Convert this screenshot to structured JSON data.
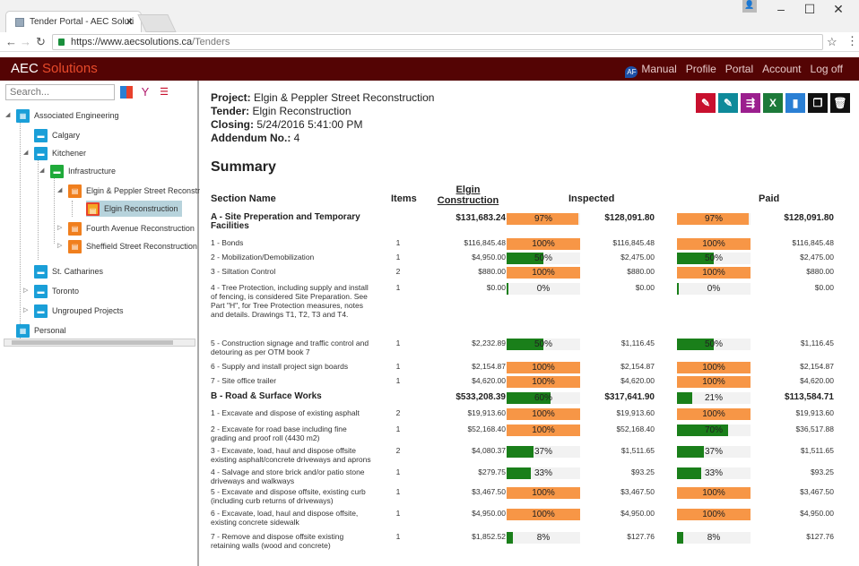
{
  "browser": {
    "tab_title": "Tender Portal - AEC Soluti",
    "url_host": "https://www.aecsolutions.ca",
    "url_path": "/Tenders"
  },
  "app": {
    "brand_a": "AEC",
    "brand_b": "Solutions",
    "nav": [
      "Manual",
      "Profile",
      "Portal",
      "Account",
      "Log off"
    ]
  },
  "sidebar": {
    "search_placeholder": "Search...",
    "tree": [
      {
        "label": "Associated Engineering"
      },
      {
        "label": "Calgary"
      },
      {
        "label": "Kitchener"
      },
      {
        "label": "Infrastructure"
      },
      {
        "label": "Elgin & Peppler Street Reconstr"
      },
      {
        "label": "Elgin Reconstruction"
      },
      {
        "label": "Fourth Avenue Reconstruction"
      },
      {
        "label": "Sheffield Street Reconstruction"
      },
      {
        "label": "St. Catharines"
      },
      {
        "label": "Toronto"
      },
      {
        "label": "Ungrouped Projects"
      },
      {
        "label": "Personal"
      }
    ]
  },
  "project": {
    "project_label": "Project:",
    "project": "Elgin & Peppler Street Reconstruction",
    "tender_label": "Tender:",
    "tender": "Elgin Reconstruction",
    "closing_label": "Closing:",
    "closing": "5/24/2016 5:41:00 PM",
    "addendum_label": "Addendum No.:",
    "addendum": "4"
  },
  "summary_title": "Summary",
  "table": {
    "headers": {
      "section": "Section Name",
      "items": "Items",
      "elgin": "Elgin Construction",
      "inspected": "Inspected",
      "paid": "Paid"
    },
    "rows": [
      {
        "name": "A - Site Preperation and Temporary Facilities",
        "items": "",
        "amt": "$131,683.24",
        "ins_pct": "97%",
        "ins_amt": "$128,091.80",
        "paid_pct": "97%",
        "paid_amt": "$128,091.80",
        "sec": true
      },
      {
        "name": "1 - Bonds",
        "items": "1",
        "amt": "$116,845.48",
        "ins_pct": "100%",
        "ins_amt": "$116,845.48",
        "paid_pct": "100%",
        "paid_amt": "$116,845.48"
      },
      {
        "name": "2 - Mobilization/Demobilization",
        "items": "1",
        "amt": "$4,950.00",
        "ins_pct": "50%",
        "ins_amt": "$2,475.00",
        "paid_pct": "50%",
        "paid_amt": "$2,475.00"
      },
      {
        "name": "3 - Siltation Control",
        "items": "2",
        "amt": "$880.00",
        "ins_pct": "100%",
        "ins_amt": "$880.00",
        "paid_pct": "100%",
        "paid_amt": "$880.00"
      },
      {
        "name": "4 - Tree Protection, including supply and install of fencing, is considered Site Preparation. See Part \"H\", for Tree Protection measures, notes and details. Drawings T1, T2, T3 and T4.",
        "items": "1",
        "amt": "$0.00",
        "ins_pct": "0%",
        "ins_amt": "$0.00",
        "paid_pct": "0%",
        "paid_amt": "$0.00"
      },
      {
        "name": "5 - Construction signage and traffic control and detouring as per OTM book 7",
        "items": "1",
        "amt": "$2,232.89",
        "ins_pct": "50%",
        "ins_amt": "$1,116.45",
        "paid_pct": "50%",
        "paid_amt": "$1,116.45"
      },
      {
        "name": "6 - Supply and install project sign boards",
        "items": "1",
        "amt": "$2,154.87",
        "ins_pct": "100%",
        "ins_amt": "$2,154.87",
        "paid_pct": "100%",
        "paid_amt": "$2,154.87"
      },
      {
        "name": "7 - Site office trailer",
        "items": "1",
        "amt": "$4,620.00",
        "ins_pct": "100%",
        "ins_amt": "$4,620.00",
        "paid_pct": "100%",
        "paid_amt": "$4,620.00"
      },
      {
        "name": "B - Road & Surface Works",
        "items": "",
        "amt": "$533,208.39",
        "ins_pct": "60%",
        "ins_amt": "$317,641.90",
        "paid_pct": "21%",
        "paid_amt": "$113,584.71",
        "sec": true
      },
      {
        "name": "1 - Excavate and dispose of existing asphalt",
        "items": "2",
        "amt": "$19,913.60",
        "ins_pct": "100%",
        "ins_amt": "$19,913.60",
        "paid_pct": "100%",
        "paid_amt": "$19,913.60"
      },
      {
        "name": "2 - Excavate for road base including fine grading and proof roll (4430 m2)",
        "items": "1",
        "amt": "$52,168.40",
        "ins_pct": "100%",
        "ins_amt": "$52,168.40",
        "paid_pct": "70%",
        "paid_amt": "$36,517.88"
      },
      {
        "name": "3 - Excavate, load, haul and dispose offsite existing asphalt/concrete driveways and aprons",
        "items": "2",
        "amt": "$4,080.37",
        "ins_pct": "37%",
        "ins_amt": "$1,511.65",
        "paid_pct": "37%",
        "paid_amt": "$1,511.65"
      },
      {
        "name": "4 - Salvage and store brick and/or patio stone driveways and walkways",
        "items": "1",
        "amt": "$279.75",
        "ins_pct": "33%",
        "ins_amt": "$93.25",
        "paid_pct": "33%",
        "paid_amt": "$93.25"
      },
      {
        "name": "5 - Excavate and dispose offsite, existing curb (including curb returns of driveways)",
        "items": "1",
        "amt": "$3,467.50",
        "ins_pct": "100%",
        "ins_amt": "$3,467.50",
        "paid_pct": "100%",
        "paid_amt": "$3,467.50"
      },
      {
        "name": "6 - Excavate, load, haul and dispose offsite, existing concrete sidewalk",
        "items": "1",
        "amt": "$4,950.00",
        "ins_pct": "100%",
        "ins_amt": "$4,950.00",
        "paid_pct": "100%",
        "paid_amt": "$4,950.00"
      },
      {
        "name": "7 - Remove and dispose offsite existing retaining walls (wood and concrete)",
        "items": "1",
        "amt": "$1,852.52",
        "ins_pct": "8%",
        "ins_amt": "$127.76",
        "paid_pct": "8%",
        "paid_amt": "$127.76"
      }
    ]
  },
  "colors": {
    "full": "#f79646",
    "partial": "#1a7f1a",
    "header": "#540404"
  }
}
